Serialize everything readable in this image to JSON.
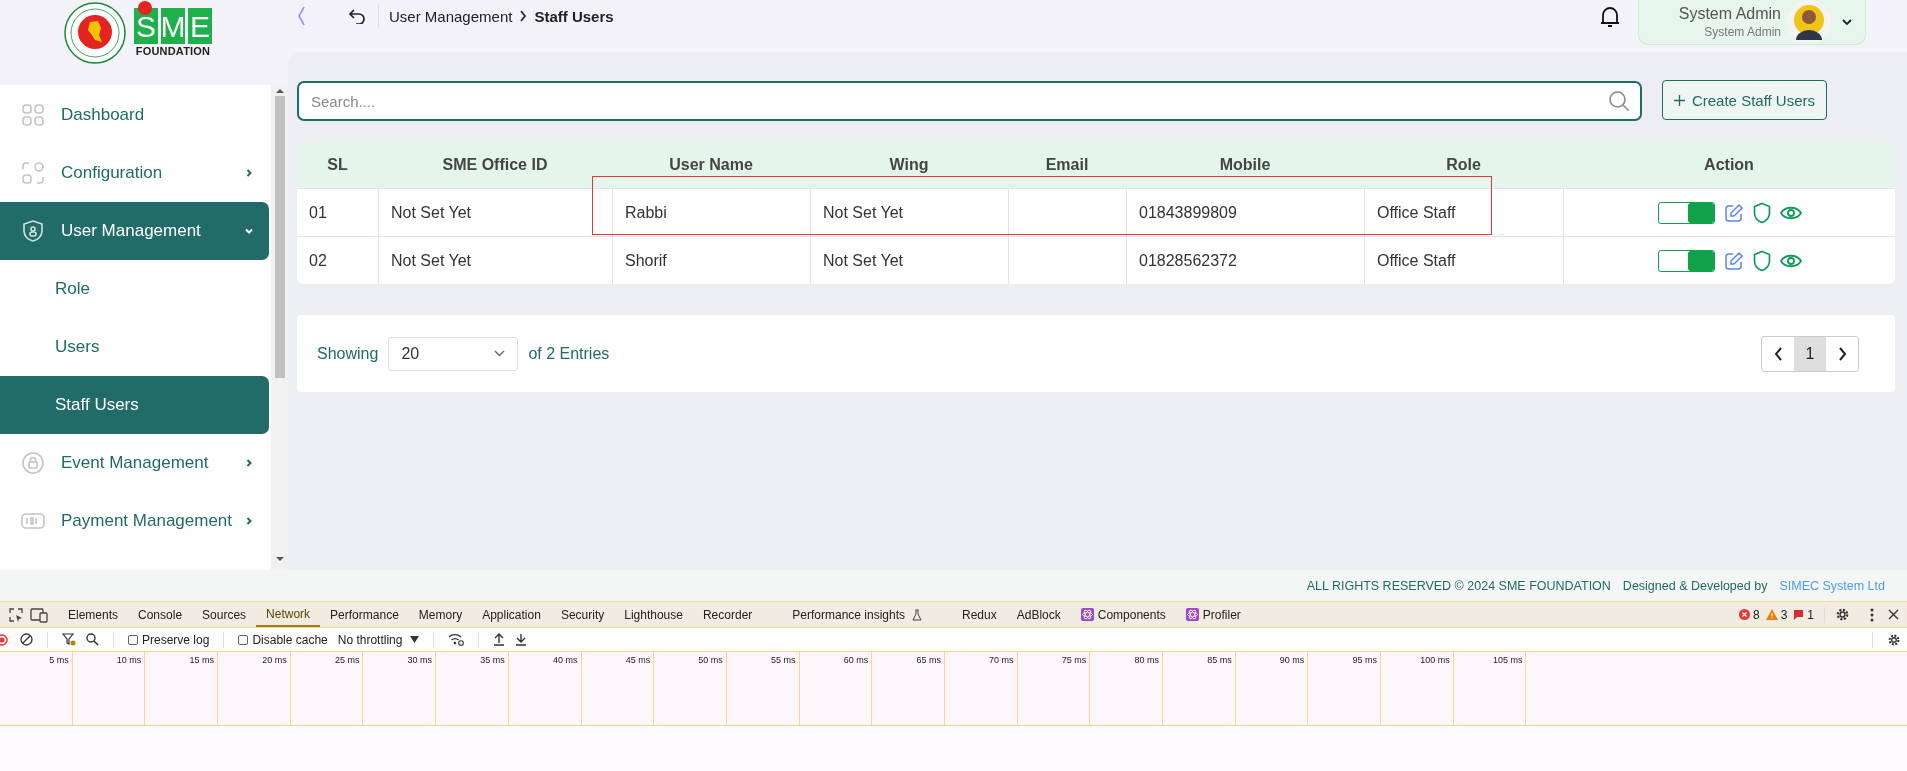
{
  "logo": {
    "letters": [
      "S",
      "M",
      "E"
    ],
    "subtext": "FOUNDATION"
  },
  "header": {
    "breadcrumb": [
      "User Management",
      "Staff Users"
    ],
    "user": {
      "name": "System Admin",
      "role": "System Admin"
    }
  },
  "sidebar": {
    "items": [
      {
        "label": "Dashboard",
        "kind": "grid",
        "selected": false
      },
      {
        "label": "Configuration",
        "kind": "config",
        "selected": false,
        "expanded": false
      },
      {
        "label": "User Management",
        "kind": "shield",
        "selected": true,
        "expanded": true,
        "children": [
          {
            "label": "Role",
            "selected": false
          },
          {
            "label": "Users",
            "selected": false
          },
          {
            "label": "Staff Users",
            "selected": true
          }
        ]
      },
      {
        "label": "Event Management",
        "kind": "lock",
        "selected": false,
        "expanded": false
      },
      {
        "label": "Payment Management",
        "kind": "payment",
        "selected": false,
        "expanded": false
      }
    ]
  },
  "search": {
    "placeholder": "Search...."
  },
  "create_button": "Create Staff Users",
  "table": {
    "columns": [
      "SL",
      "SME Office ID",
      "User Name",
      "Wing",
      "Email",
      "Mobile",
      "Role",
      "Action"
    ],
    "rows": [
      {
        "sl": "01",
        "office_id": "Not Set Yet",
        "user_name": "Rabbi",
        "wing": "Not Set Yet",
        "mobile": "01843899809",
        "role": "Office Staff",
        "active": true
      },
      {
        "sl": "02",
        "office_id": "Not Set Yet",
        "user_name": "Shorif",
        "wing": "Not Set Yet",
        "mobile": "01828562372",
        "role": "Office Staff",
        "active": true
      }
    ]
  },
  "pagination": {
    "label": "Showing",
    "page_size": "20",
    "suffix": "of 2 Entries",
    "pages": [
      {
        "label": "1",
        "selected": true
      }
    ]
  },
  "footer": {
    "copyright": "ALL RIGHTS RESERVED © 2024 SME FOUNDATION",
    "credit": "Designed & Developed by",
    "credit_link": "SIMEC System Ltd"
  },
  "devtools": {
    "tabs": [
      {
        "label": "Elements",
        "kind": "plain",
        "selected": false
      },
      {
        "label": "Console",
        "kind": "plain",
        "selected": false
      },
      {
        "label": "Sources",
        "kind": "plain",
        "selected": false
      },
      {
        "label": "Network",
        "kind": "plain",
        "selected": true
      },
      {
        "label": "Performance",
        "kind": "plain",
        "selected": false
      },
      {
        "label": "Memory",
        "kind": "plain",
        "selected": false
      },
      {
        "label": "Application",
        "kind": "plain",
        "selected": false
      },
      {
        "label": "Security",
        "kind": "plain",
        "selected": false
      },
      {
        "label": "Lighthouse",
        "kind": "plain",
        "selected": false
      },
      {
        "label": "Recorder",
        "kind": "plain",
        "selected": false
      },
      {
        "label": "Performance insights",
        "kind": "flask",
        "selected": false
      },
      {
        "label": "Redux",
        "kind": "plain",
        "selected": false
      },
      {
        "label": "AdBlock",
        "kind": "plain",
        "selected": false
      },
      {
        "label": "Components",
        "kind": "react",
        "selected": false
      },
      {
        "label": "Profiler",
        "kind": "react",
        "selected": false
      }
    ],
    "errors": "8",
    "warnings": "3",
    "issues": "1",
    "preserve_log": {
      "label": "Preserve log",
      "checked": false
    },
    "disable_cache": {
      "label": "Disable cache",
      "checked": false
    },
    "throttling": "No throttling",
    "ticks": [
      "5 ms",
      "10 ms",
      "15 ms",
      "20 ms",
      "25 ms",
      "30 ms",
      "35 ms",
      "40 ms",
      "45 ms",
      "50 ms",
      "55 ms",
      "60 ms",
      "65 ms",
      "70 ms",
      "75 ms",
      "80 ms",
      "85 ms",
      "90 ms",
      "95 ms",
      "100 ms",
      "105 ms"
    ]
  }
}
